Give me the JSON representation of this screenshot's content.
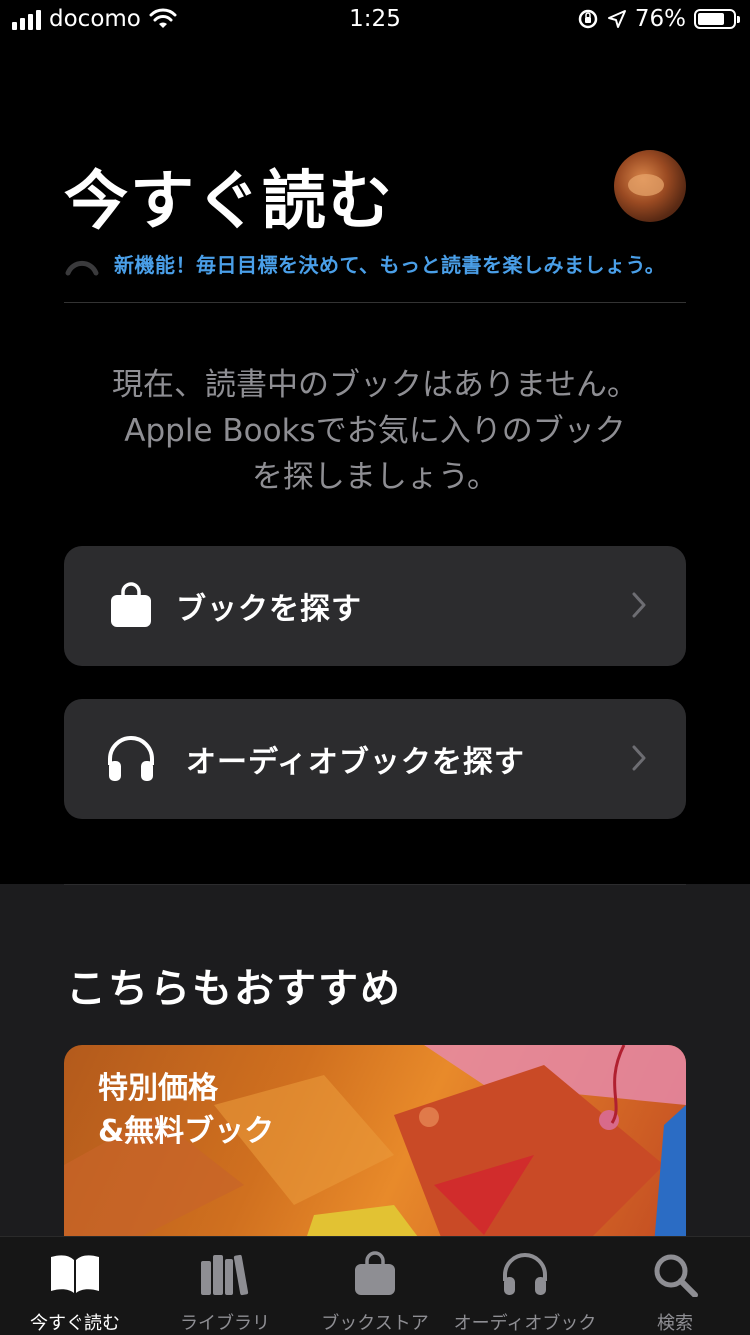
{
  "status_bar": {
    "carrier": "docomo",
    "time": "1:25",
    "battery_percent": "76%",
    "battery_level": 0.76
  },
  "header": {
    "title": "今すぐ読む",
    "avatar_icon": "profile-photo",
    "goal_text": "新機能！毎日目標を決めて、もっと読書を楽しみましょう。",
    "goal_color": "#4a9fe8"
  },
  "empty_message": "現在、読書中のブックはありません。Apple Booksでお気に入りのブックを探しましょう。",
  "actions": [
    {
      "label": "ブックを探す",
      "icon": "shopping-bag-icon"
    },
    {
      "label": "オーディオブックを探す",
      "icon": "headphones-icon"
    }
  ],
  "recommend": {
    "title": "こちらもおすすめ",
    "promo_title": "特別価格\n&無料ブック"
  },
  "tabs": [
    {
      "label": "今すぐ読む",
      "icon": "open-book-icon",
      "active": true
    },
    {
      "label": "ライブラリ",
      "icon": "library-icon",
      "active": false
    },
    {
      "label": "ブックストア",
      "icon": "shopping-bag-icon",
      "active": false
    },
    {
      "label": "オーディオブック",
      "icon": "headphones-icon",
      "active": false
    },
    {
      "label": "検索",
      "icon": "search-icon",
      "active": false
    }
  ]
}
